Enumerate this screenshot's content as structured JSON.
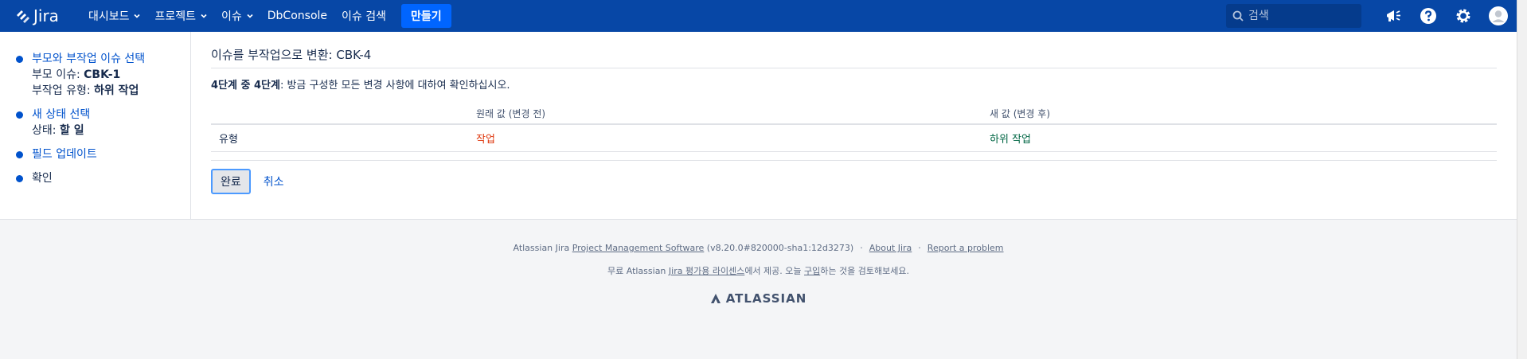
{
  "header": {
    "logo_text": "Jira",
    "nav": [
      {
        "label": "대시보드",
        "dropdown": true
      },
      {
        "label": "프로젝트",
        "dropdown": true
      },
      {
        "label": "이슈",
        "dropdown": true
      },
      {
        "label": "DbConsole",
        "dropdown": false
      },
      {
        "label": "이슈 검색",
        "dropdown": false
      }
    ],
    "create_label": "만들기",
    "search_placeholder": "검색"
  },
  "sidebar": {
    "steps": [
      {
        "title": "부모와 부작업 이슈 선택",
        "link": true,
        "sub": [
          {
            "label": "부모 이슈: ",
            "value": "CBK-1"
          },
          {
            "label": "부작업 유형: ",
            "value": "하위 작업"
          }
        ]
      },
      {
        "title": "새 상태 선택",
        "link": true,
        "sub": [
          {
            "label": "상태: ",
            "value": "할 일"
          }
        ]
      },
      {
        "title": "필드 업데이트",
        "link": true,
        "sub": []
      },
      {
        "title": "확인",
        "link": false,
        "sub": []
      }
    ]
  },
  "main": {
    "heading": "이슈를 부작업으로 변환: CBK-4",
    "step_prefix": "4단계 중 4단계",
    "step_text": ": 방금 구성한 모든 변경 사항에 대하여 확인하십시오.",
    "table": {
      "headers": [
        "",
        "원래 값 (변경 전)",
        "새 값 (변경 후)"
      ],
      "rows": [
        {
          "field": "유형",
          "old": "작업",
          "new": "하위 작업"
        }
      ]
    },
    "done_label": "완료",
    "cancel_label": "취소"
  },
  "footer": {
    "line1_prefix": "Atlassian Jira ",
    "line1_link": "Project Management Software",
    "line1_version": " (v8.20.0#820000-sha1:12d3273)",
    "about": "About Jira",
    "report": "Report a problem",
    "line2_a": "무료 Atlassian ",
    "line2_link": "Jira 평가용 라이센스",
    "line2_b": "에서 제공. 오늘 ",
    "line2_buy": "구입",
    "line2_c": "하는 것을 검토해보세요.",
    "brand": "ATLASSIAN"
  },
  "colors": {
    "header_bg": "#0747a6",
    "create_btn": "#0065ff",
    "link": "#0052cc",
    "old_value": "#de350b",
    "new_value": "#006644"
  }
}
